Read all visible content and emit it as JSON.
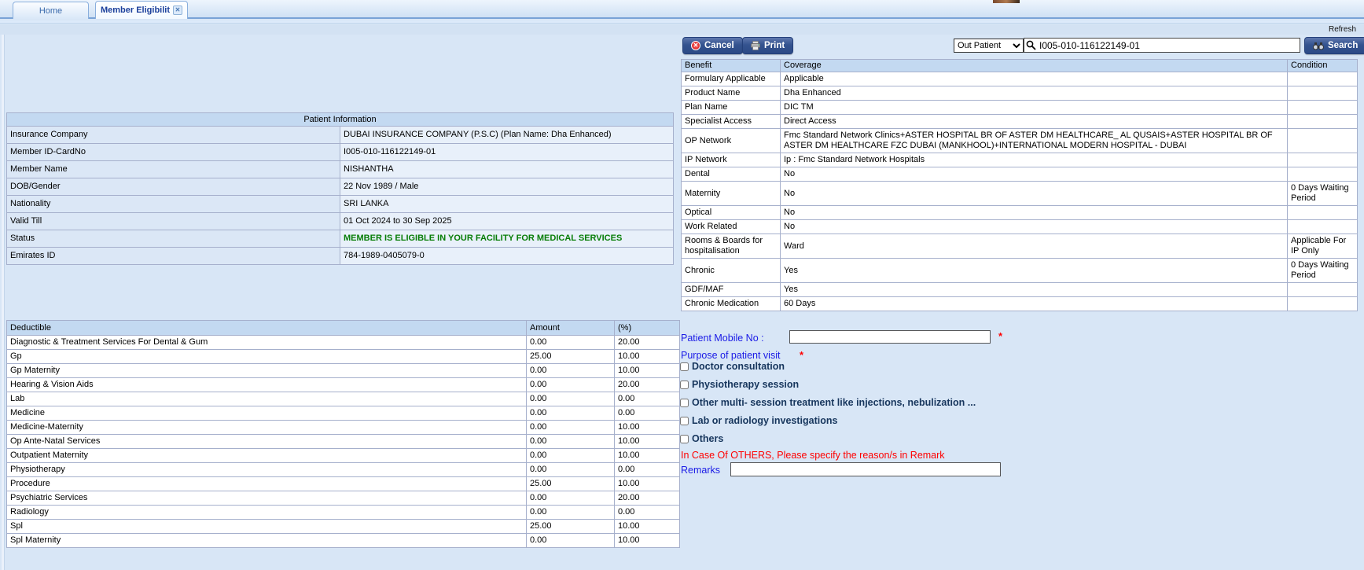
{
  "tabs": [
    {
      "label": "Home",
      "active": false
    },
    {
      "label": "Member Eligibilit",
      "active": true
    }
  ],
  "refresh_label": "Refresh",
  "toolbar": {
    "cancel_label": "Cancel",
    "print_label": "Print",
    "visit_type_selected": "Out Patient",
    "search_value": "I005-010-116122149-01",
    "search_label": "Search"
  },
  "patient_info": {
    "title": "Patient Information",
    "rows": [
      {
        "label": "Insurance Company",
        "value": "DUBAI INSURANCE COMPANY (P.S.C) (Plan Name: Dha Enhanced)",
        "highlight": false
      },
      {
        "label": "Member ID-CardNo",
        "value": "I005-010-116122149-01",
        "highlight": false
      },
      {
        "label": "Member Name",
        "value": "NISHANTHA",
        "highlight": false
      },
      {
        "label": "DOB/Gender",
        "value": "22 Nov 1989 / Male",
        "highlight": false
      },
      {
        "label": "Nationality",
        "value": "SRI LANKA",
        "highlight": false
      },
      {
        "label": "Valid Till",
        "value": "01 Oct 2024 to 30 Sep 2025",
        "highlight": false
      },
      {
        "label": "Status",
        "value": "MEMBER IS ELIGIBLE IN YOUR FACILITY FOR MEDICAL SERVICES",
        "highlight": true
      },
      {
        "label": "Emirates ID",
        "value": "784-1989-0405079-0",
        "highlight": false
      }
    ]
  },
  "benefits": {
    "headers": [
      "Benefit",
      "Coverage",
      "Condition"
    ],
    "rows": [
      {
        "benefit": "Formulary Applicable",
        "coverage": "Applicable",
        "condition": ""
      },
      {
        "benefit": "Product Name",
        "coverage": "Dha Enhanced",
        "condition": ""
      },
      {
        "benefit": "Plan Name",
        "coverage": "DIC TM",
        "condition": ""
      },
      {
        "benefit": "Specialist Access",
        "coverage": "Direct Access",
        "condition": ""
      },
      {
        "benefit": "OP Network",
        "coverage": "Fmc Standard Network Clinics+ASTER HOSPITAL BR OF ASTER DM HEALTHCARE_ AL QUSAIS+ASTER HOSPITAL BR OF ASTER DM HEALTHCARE FZC DUBAI (MANKHOOL)+INTERNATIONAL MODERN HOSPITAL - DUBAI",
        "condition": ""
      },
      {
        "benefit": "IP Network",
        "coverage": "Ip : Fmc Standard Network Hospitals",
        "condition": ""
      },
      {
        "benefit": "Dental",
        "coverage": "No",
        "condition": ""
      },
      {
        "benefit": "Maternity",
        "coverage": "No",
        "condition": "0 Days Waiting Period"
      },
      {
        "benefit": "Optical",
        "coverage": "No",
        "condition": ""
      },
      {
        "benefit": "Work Related",
        "coverage": "No",
        "condition": ""
      },
      {
        "benefit": "Rooms & Boards for hospitalisation",
        "coverage": "Ward",
        "condition": "Applicable For IP Only"
      },
      {
        "benefit": "Chronic",
        "coverage": "Yes",
        "condition": "0 Days Waiting Period"
      },
      {
        "benefit": "GDF/MAF",
        "coverage": "Yes",
        "condition": ""
      },
      {
        "benefit": "Chronic Medication",
        "coverage": "60 Days",
        "condition": ""
      }
    ]
  },
  "deductibles": {
    "headers": [
      "Deductible",
      "Amount",
      "(%)"
    ],
    "rows": [
      {
        "name": "Diagnostic & Treatment Services For Dental & Gum",
        "amount": "0.00",
        "percent": "20.00"
      },
      {
        "name": "Gp",
        "amount": "25.00",
        "percent": "10.00"
      },
      {
        "name": "Gp Maternity",
        "amount": "0.00",
        "percent": "10.00"
      },
      {
        "name": "Hearing & Vision Aids",
        "amount": "0.00",
        "percent": "20.00"
      },
      {
        "name": "Lab",
        "amount": "0.00",
        "percent": "0.00"
      },
      {
        "name": "Medicine",
        "amount": "0.00",
        "percent": "0.00"
      },
      {
        "name": "Medicine-Maternity",
        "amount": "0.00",
        "percent": "10.00"
      },
      {
        "name": "Op Ante-Natal Services",
        "amount": "0.00",
        "percent": "10.00"
      },
      {
        "name": "Outpatient Maternity",
        "amount": "0.00",
        "percent": "10.00"
      },
      {
        "name": "Physiotherapy",
        "amount": "0.00",
        "percent": "0.00"
      },
      {
        "name": "Procedure",
        "amount": "25.00",
        "percent": "10.00"
      },
      {
        "name": "Psychiatric Services",
        "amount": "0.00",
        "percent": "20.00"
      },
      {
        "name": "Radiology",
        "amount": "0.00",
        "percent": "0.00"
      },
      {
        "name": "Spl",
        "amount": "25.00",
        "percent": "10.00"
      },
      {
        "name": "Spl Maternity",
        "amount": "0.00",
        "percent": "10.00"
      }
    ]
  },
  "visit_form": {
    "mobile_label": "Patient Mobile No :",
    "mobile_value": "",
    "required_marker": "*",
    "purpose_label": "Purpose of patient visit",
    "options": [
      "Doctor consultation",
      "Physiotherapy session",
      "Other multi- session treatment like injections, nebulization ...",
      "Lab or radiology investigations",
      "Others"
    ],
    "others_note": "In Case Of OTHERS, Please specify the reason/s in Remark",
    "remarks_label": "Remarks",
    "remarks_value": ""
  },
  "colors": {
    "page-bg": "#d8e6f6",
    "header-bg": "#c3d9f1",
    "label-cell-bg": "#dbe7f6",
    "value-cell-bg": "#e8f0fa",
    "table-border": "#a6b0cc",
    "button-bg2": "#2c4a86",
    "status-green": "#067d06",
    "form-blue": "#1a1ae6",
    "navy-label": "#17365d",
    "alert-red": "#ff0000",
    "active-tab-text": "#1b3f9b"
  }
}
